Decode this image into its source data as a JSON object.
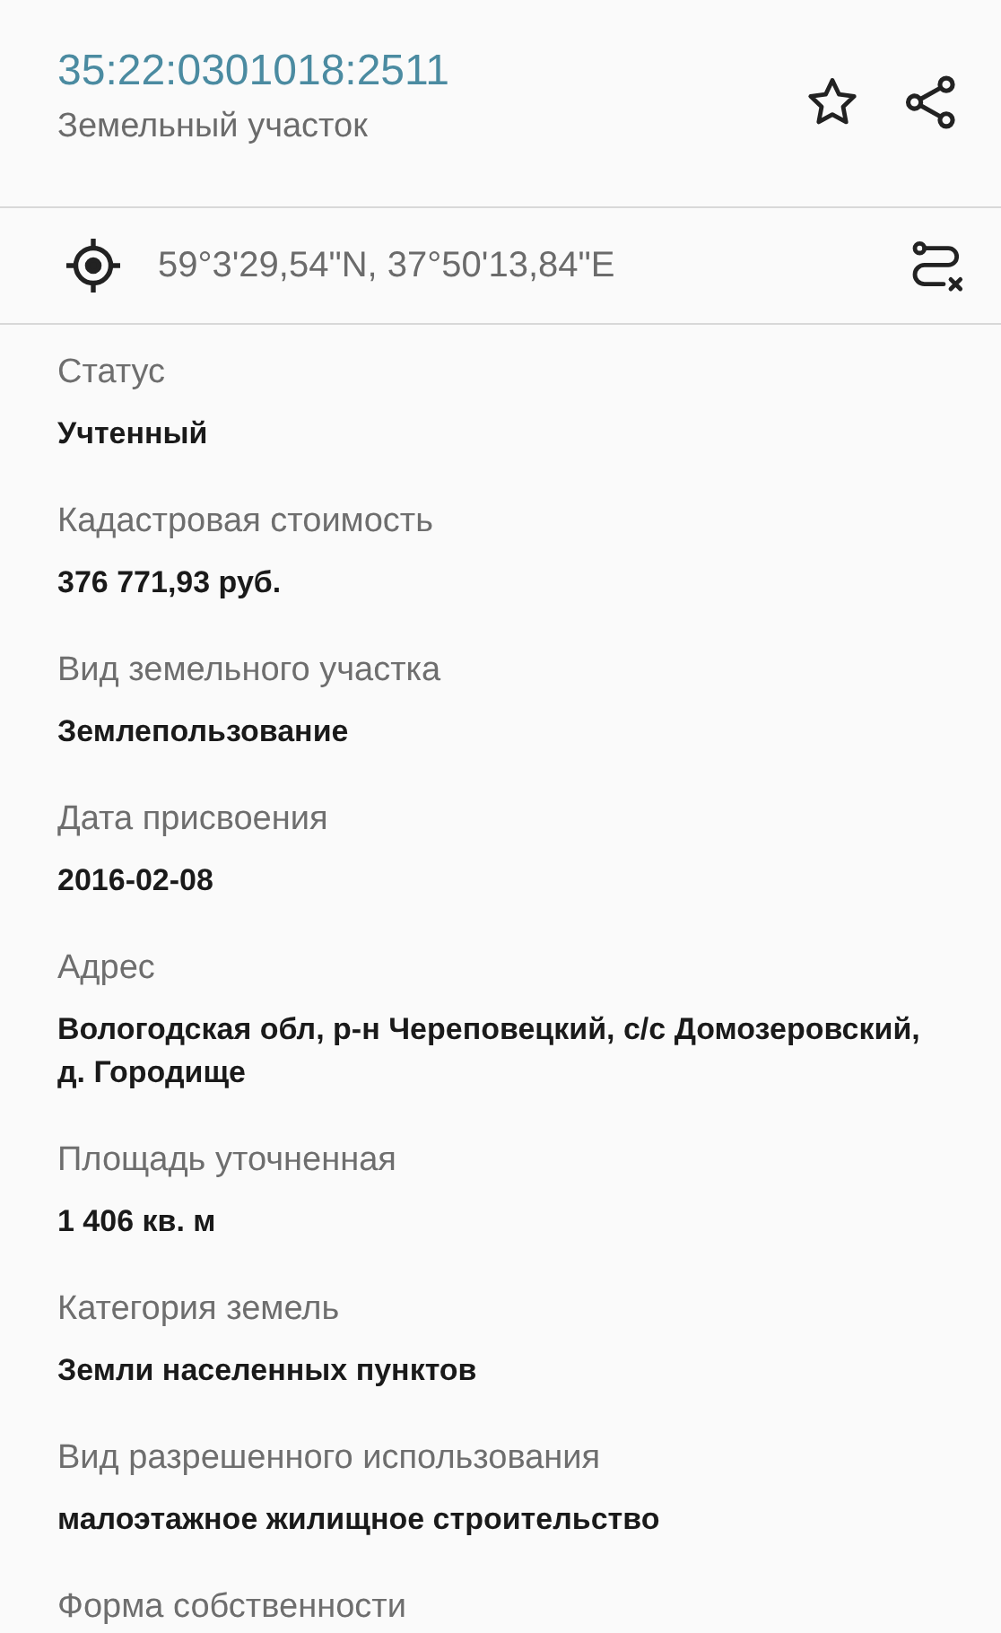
{
  "header": {
    "title": "35:22:0301018:2511",
    "subtitle": "Земельный участок"
  },
  "coordinates": {
    "text": "59°3'29,54\"N, 37°50'13,84\"E"
  },
  "fields": [
    {
      "label": "Статус",
      "value": "Учтенный"
    },
    {
      "label": "Кадастровая стоимость",
      "value": "376 771,93 руб."
    },
    {
      "label": "Вид земельного участка",
      "value": "Землепользование"
    },
    {
      "label": "Дата присвоения",
      "value": "2016-02-08"
    },
    {
      "label": "Адрес",
      "value": "Вологодская обл, р-н Череповецкий, с/с Домозеровский, д. Городище"
    },
    {
      "label": "Площадь уточненная",
      "value": "1 406 кв. м"
    },
    {
      "label": "Категория земель",
      "value": "Земли населенных пунктов"
    },
    {
      "label": "Вид разрешенного использования",
      "value": "малоэтажное жилищное строительство"
    },
    {
      "label": "Форма собственности"
    }
  ]
}
